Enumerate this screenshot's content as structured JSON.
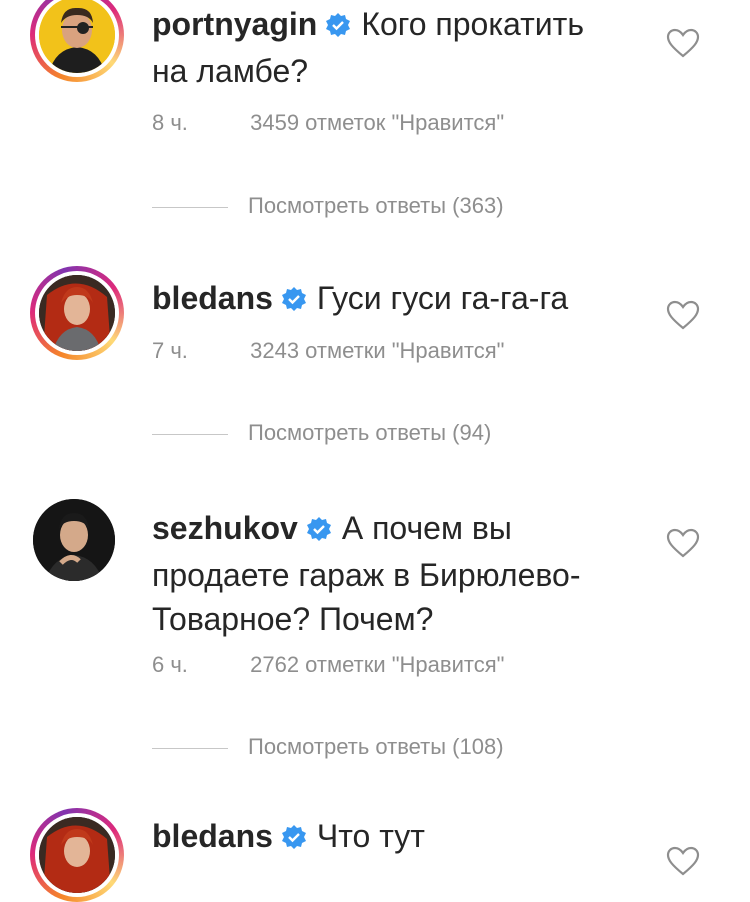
{
  "comments": [
    {
      "username": "portnyagin",
      "text": "Кого прокатить на ламбе?",
      "time": "8 ч.",
      "likes": "3459 отметок \"Нравится\"",
      "replies": "Посмотреть ответы (363)"
    },
    {
      "username": "bledans",
      "text": "Гуси гуси га-га-га",
      "time": "7 ч.",
      "likes": "3243 отметки \"Нравится\"",
      "replies": "Посмотреть ответы (94)"
    },
    {
      "username": "sezhukov",
      "text": "А почем вы продаете гараж в Бирюлево-Товарное? Почем?",
      "time": "6 ч.",
      "likes": "2762 отметки \"Нравится\"",
      "replies": "Посмотреть ответы (108)"
    },
    {
      "username": "bledans",
      "text": "Что тут"
    }
  ],
  "colors": {
    "verified": "#3897f0",
    "muted": "#8e8e8e",
    "text": "#262626"
  }
}
